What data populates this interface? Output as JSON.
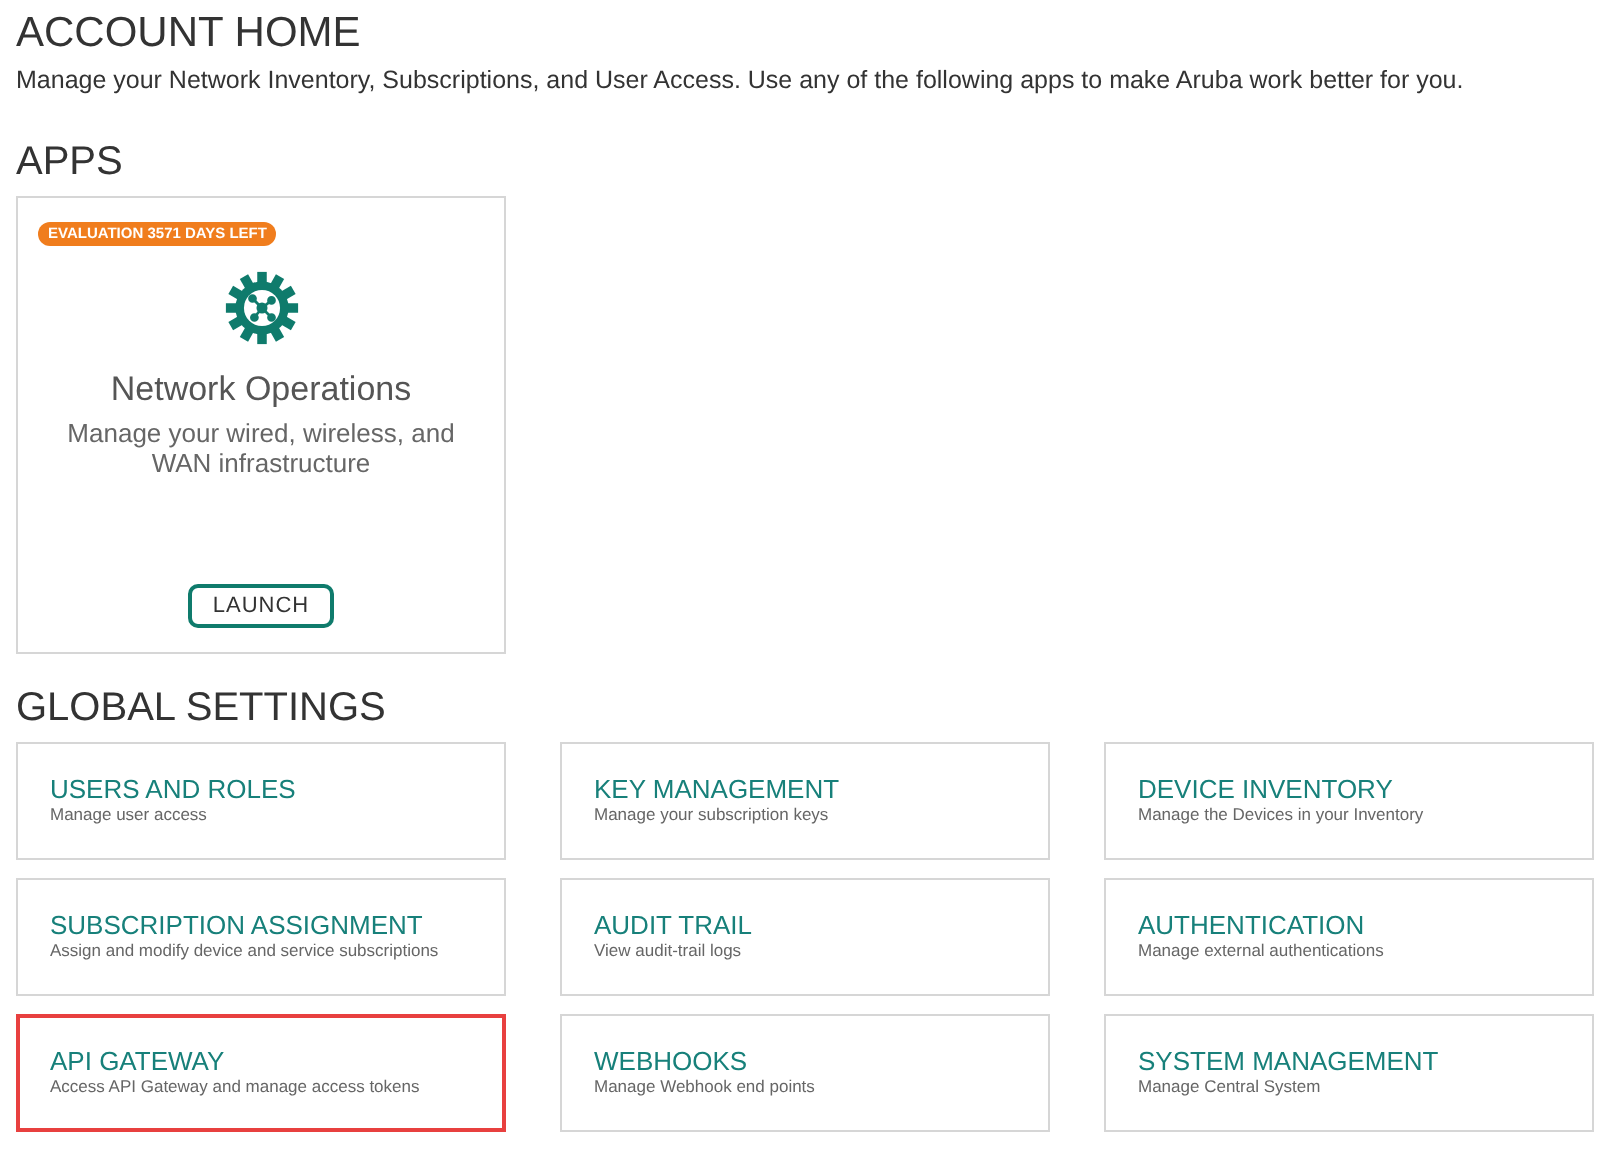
{
  "header": {
    "title": "ACCOUNT HOME",
    "subtitle": "Manage your Network Inventory, Subscriptions, and User Access. Use any of the following apps to make Aruba work better for you."
  },
  "apps": {
    "heading": "APPS",
    "cards": [
      {
        "badge": "EVALUATION 3571 DAYS LEFT",
        "title": "Network Operations",
        "description": "Manage your wired, wireless, and WAN infrastructure",
        "button": "LAUNCH"
      }
    ]
  },
  "global_settings": {
    "heading": "GLOBAL SETTINGS",
    "items": [
      {
        "title": "USERS AND ROLES",
        "description": "Manage user access",
        "highlighted": false
      },
      {
        "title": "KEY MANAGEMENT",
        "description": "Manage your subscription keys",
        "highlighted": false
      },
      {
        "title": "DEVICE INVENTORY",
        "description": "Manage the Devices in your Inventory",
        "highlighted": false
      },
      {
        "title": "SUBSCRIPTION ASSIGNMENT",
        "description": "Assign and modify device and service subscriptions",
        "highlighted": false
      },
      {
        "title": "AUDIT TRAIL",
        "description": "View audit-trail logs",
        "highlighted": false
      },
      {
        "title": "AUTHENTICATION",
        "description": "Manage external authentications",
        "highlighted": false
      },
      {
        "title": "API GATEWAY",
        "description": "Access API Gateway and manage access tokens",
        "highlighted": true
      },
      {
        "title": "WEBHOOKS",
        "description": "Manage Webhook end points",
        "highlighted": false
      },
      {
        "title": "SYSTEM MANAGEMENT",
        "description": "Manage Central System",
        "highlighted": false
      }
    ]
  }
}
